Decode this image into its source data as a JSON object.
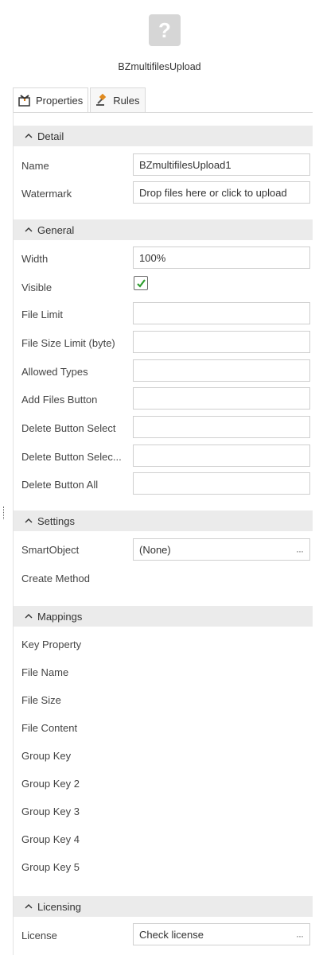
{
  "header": {
    "icon": "question-mark-icon",
    "control_name": "BZmultifilesUpload"
  },
  "tabs": [
    {
      "label": "Properties",
      "icon": "properties-icon",
      "active": true
    },
    {
      "label": "Rules",
      "icon": "rules-gavel-icon",
      "active": false
    }
  ],
  "sections": {
    "detail": {
      "title": "Detail",
      "props": {
        "name_label": "Name",
        "name_value": "BZmultifilesUpload1",
        "watermark_label": "Watermark",
        "watermark_value": "Drop files here or click to upload"
      }
    },
    "general": {
      "title": "General",
      "props": {
        "width_label": "Width",
        "width_value": "100%",
        "visible_label": "Visible",
        "visible_checked": true,
        "file_limit_label": "File Limit",
        "file_limit_value": "",
        "file_size_limit_label": "File Size Limit (byte)",
        "file_size_limit_value": "",
        "allowed_types_label": "Allowed Types",
        "allowed_types_value": "",
        "add_files_button_label": "Add Files Button",
        "add_files_button_value": "",
        "delete_button_select_label": "Delete Button Select",
        "delete_button_select_value": "",
        "delete_button_select2_label": "Delete Button Selec...",
        "delete_button_select2_value": "",
        "delete_button_all_label": "Delete Button All",
        "delete_button_all_value": ""
      }
    },
    "settings": {
      "title": "Settings",
      "props": {
        "smartobject_label": "SmartObject",
        "smartobject_value": "(None)",
        "create_method_label": "Create Method"
      }
    },
    "mappings": {
      "title": "Mappings",
      "items": [
        "Key Property",
        "File Name",
        "File Size",
        "File Content",
        "Group Key",
        "Group Key 2",
        "Group Key 3",
        "Group Key 4",
        "Group Key 5"
      ]
    },
    "licensing": {
      "title": "Licensing",
      "props": {
        "license_label": "License",
        "license_value": "Check license"
      }
    }
  },
  "ellipsis_glyph": "···",
  "colors": {
    "section_bg": "#ebebeb",
    "checkmark": "#2e9e2e"
  }
}
